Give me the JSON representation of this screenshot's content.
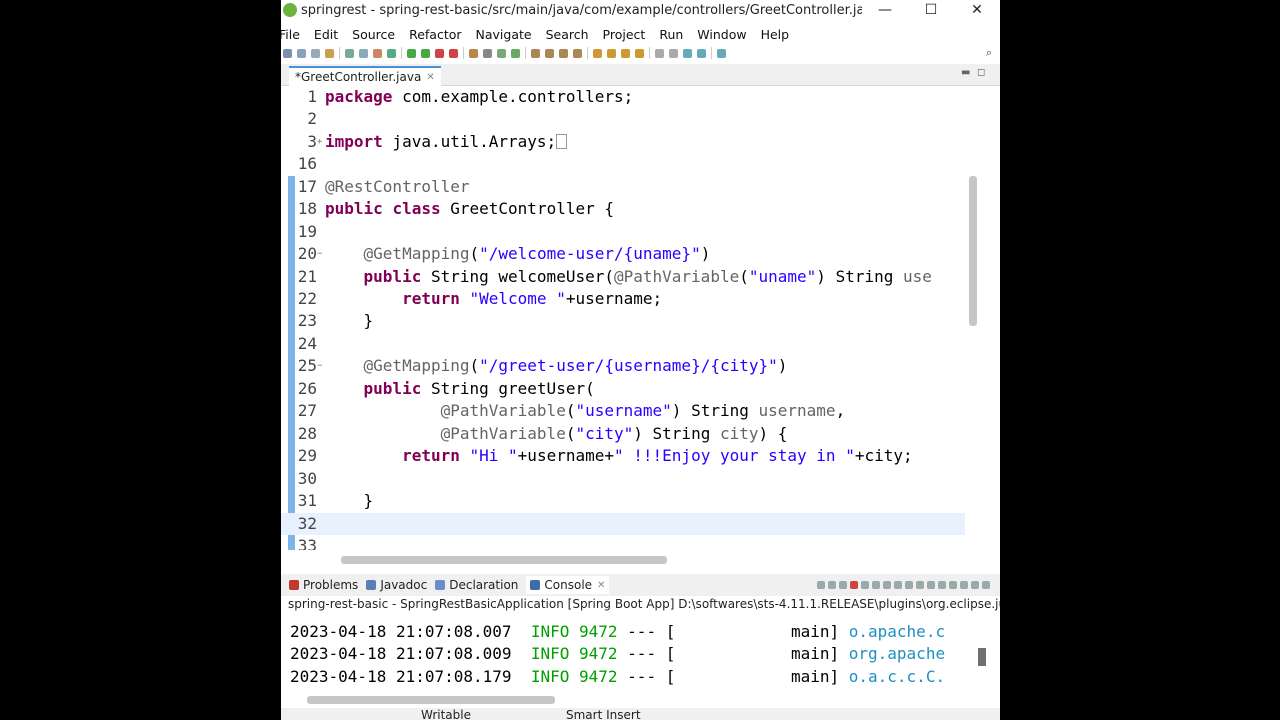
{
  "window": {
    "title": "springrest - spring-rest-basic/src/main/java/com/example/controllers/GreetController.java - Spring Too...",
    "minimize": "—",
    "maximize": "☐",
    "close": "✕"
  },
  "menu": [
    "File",
    "Edit",
    "Source",
    "Refactor",
    "Navigate",
    "Search",
    "Project",
    "Run",
    "Window",
    "Help"
  ],
  "editor": {
    "tab_label": "*GreetController.java",
    "tab_close": "✕",
    "lines": [
      {
        "n": "1",
        "html": "<span class=\"kw\">package</span> com.example.controllers;"
      },
      {
        "n": "2",
        "html": ""
      },
      {
        "n": "3",
        "fold": "+",
        "html": "<span class=\"kw\">import</span> java.util.Arrays;<span class=\"caret-box\"></span>"
      },
      {
        "n": "16",
        "html": ""
      },
      {
        "n": "17",
        "html": "<span class=\"ann\">@RestController</span>"
      },
      {
        "n": "18",
        "html": "<span class=\"kw\">public</span> <span class=\"kw\">class</span> GreetController {"
      },
      {
        "n": "19",
        "html": ""
      },
      {
        "n": "20",
        "fold": "−",
        "html": "    <span class=\"ann\">@GetMapping</span>(<span class=\"str\">\"/welcome-user/{uname}\"</span>)"
      },
      {
        "n": "21",
        "html": "    <span class=\"kw\">public</span> String welcomeUser(<span class=\"ann\">@PathVariable</span>(<span class=\"str\">\"uname\"</span>) String <span class=\"ann\">use</span>"
      },
      {
        "n": "22",
        "html": "        <span class=\"kw\">return</span> <span class=\"str\">\"Welcome \"</span>+username;"
      },
      {
        "n": "23",
        "html": "    }"
      },
      {
        "n": "24",
        "html": ""
      },
      {
        "n": "25",
        "fold": "−",
        "html": "    <span class=\"ann\">@GetMapping</span>(<span class=\"str\">\"/greet-user/{username}/{city}\"</span>)"
      },
      {
        "n": "26",
        "html": "    <span class=\"kw\">public</span> String greetUser("
      },
      {
        "n": "27",
        "html": "            <span class=\"ann\">@PathVariable</span>(<span class=\"str\">\"username\"</span>) String <span class=\"ann\">username</span>,"
      },
      {
        "n": "28",
        "html": "            <span class=\"ann\">@PathVariable</span>(<span class=\"str\">\"city\"</span>) String <span class=\"ann\">city</span>) {"
      },
      {
        "n": "29",
        "html": "        <span class=\"kw\">return</span> <span class=\"str\">\"Hi \"</span>+username+<span class=\"str\">\" !!!Enjoy your stay in \"</span>+city;"
      },
      {
        "n": "30",
        "html": ""
      },
      {
        "n": "31",
        "html": "    }"
      },
      {
        "n": "32",
        "html": "",
        "current": true
      },
      {
        "n": "33",
        "html": ""
      }
    ]
  },
  "panel": {
    "tabs": [
      {
        "label": "Problems",
        "icon": "problems-icon",
        "color": "#c0392b"
      },
      {
        "label": "Javadoc",
        "icon": "javadoc-icon",
        "color": "#5b7fb5"
      },
      {
        "label": "Declaration",
        "icon": "declaration-icon",
        "color": "#6a8fc8"
      },
      {
        "label": "Console",
        "icon": "console-icon",
        "color": "#3a6ea5",
        "active": true
      }
    ],
    "console_close": "✕",
    "console_desc": "spring-rest-basic - SpringRestBasicApplication [Spring Boot App] D:\\softwares\\sts-4.11.1.RELEASE\\plugins\\org.eclipse.justj.openjdk",
    "log": [
      {
        "ts": "2023-04-18 21:07:08.007",
        "level": "INFO",
        "pid": "9472",
        "sep": "--- [",
        "thread": "main]",
        "logger": "o.apache.c"
      },
      {
        "ts": "2023-04-18 21:07:08.009",
        "level": "INFO",
        "pid": "9472",
        "sep": "--- [",
        "thread": "main]",
        "logger": "org.apache"
      },
      {
        "ts": "2023-04-18 21:07:08.179",
        "level": "INFO",
        "pid": "9472",
        "sep": "--- [",
        "thread": "main]",
        "logger": "o.a.c.c.C."
      }
    ]
  },
  "status": {
    "writable": "Writable",
    "insert_mode": "Smart Insert"
  }
}
